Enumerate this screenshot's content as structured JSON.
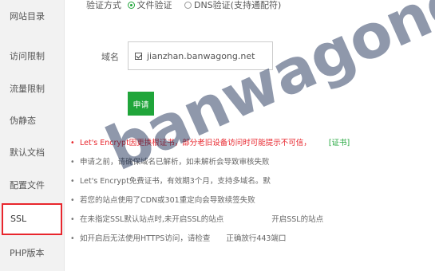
{
  "sidebar": {
    "items": [
      {
        "label": "网站目录"
      },
      {
        "label": "访问限制"
      },
      {
        "label": "流量限制"
      },
      {
        "label": "伪静态"
      },
      {
        "label": "默认文档"
      },
      {
        "label": "配置文件"
      },
      {
        "label": "SSL",
        "active": true
      },
      {
        "label": "PHP版本"
      }
    ]
  },
  "verify": {
    "label": "验证方式",
    "options": [
      {
        "label": "文件验证",
        "checked": true
      },
      {
        "label": "DNS验证(支持通配符)",
        "checked": false
      }
    ]
  },
  "domain": {
    "label": "域名",
    "items": [
      {
        "value": "jianzhan.banwagong.net",
        "checked": true
      }
    ]
  },
  "apply_button": {
    "label": "申请"
  },
  "notes": [
    {
      "text": "Let's Encrypt因更换根证书，部分老旧设备访问时可能提示不可信，",
      "link": "[证书]",
      "highlight": true
    },
    {
      "text": "申请之前，请确保域名已解析，如未解析会导致审核失败"
    },
    {
      "text": "Let's Encrypt免费证书，有效期3个月，支持多域名。默"
    },
    {
      "text": "若您的站点使用了CDN或301重定向会导致续签失败"
    },
    {
      "text": "在未指定SSL默认站点时,未开启SSL的站点"
    },
    {
      "text": "如开启后无法使用HTTPS访问，请检查"
    }
  ],
  "notes_tail": {
    "n5": "开启SSL的站点",
    "n6": "正确放行443端口"
  },
  "watermark": {
    "text": "banwagong.net"
  },
  "colors": {
    "accent": "#20a53a",
    "warning": "#e8262d",
    "sidebar_bg": "#f2f2f2"
  }
}
